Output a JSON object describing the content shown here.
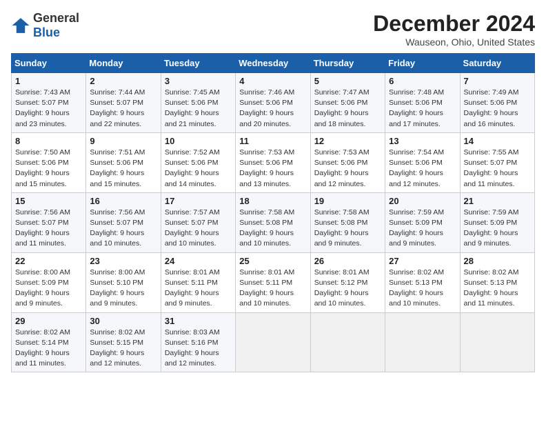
{
  "logo": {
    "general": "General",
    "blue": "Blue"
  },
  "title": "December 2024",
  "location": "Wauseon, Ohio, United States",
  "headers": [
    "Sunday",
    "Monday",
    "Tuesday",
    "Wednesday",
    "Thursday",
    "Friday",
    "Saturday"
  ],
  "weeks": [
    [
      {
        "day": "1",
        "sunrise": "Sunrise: 7:43 AM",
        "sunset": "Sunset: 5:07 PM",
        "daylight": "Daylight: 9 hours and 23 minutes."
      },
      {
        "day": "2",
        "sunrise": "Sunrise: 7:44 AM",
        "sunset": "Sunset: 5:07 PM",
        "daylight": "Daylight: 9 hours and 22 minutes."
      },
      {
        "day": "3",
        "sunrise": "Sunrise: 7:45 AM",
        "sunset": "Sunset: 5:06 PM",
        "daylight": "Daylight: 9 hours and 21 minutes."
      },
      {
        "day": "4",
        "sunrise": "Sunrise: 7:46 AM",
        "sunset": "Sunset: 5:06 PM",
        "daylight": "Daylight: 9 hours and 20 minutes."
      },
      {
        "day": "5",
        "sunrise": "Sunrise: 7:47 AM",
        "sunset": "Sunset: 5:06 PM",
        "daylight": "Daylight: 9 hours and 18 minutes."
      },
      {
        "day": "6",
        "sunrise": "Sunrise: 7:48 AM",
        "sunset": "Sunset: 5:06 PM",
        "daylight": "Daylight: 9 hours and 17 minutes."
      },
      {
        "day": "7",
        "sunrise": "Sunrise: 7:49 AM",
        "sunset": "Sunset: 5:06 PM",
        "daylight": "Daylight: 9 hours and 16 minutes."
      }
    ],
    [
      {
        "day": "8",
        "sunrise": "Sunrise: 7:50 AM",
        "sunset": "Sunset: 5:06 PM",
        "daylight": "Daylight: 9 hours and 15 minutes."
      },
      {
        "day": "9",
        "sunrise": "Sunrise: 7:51 AM",
        "sunset": "Sunset: 5:06 PM",
        "daylight": "Daylight: 9 hours and 15 minutes."
      },
      {
        "day": "10",
        "sunrise": "Sunrise: 7:52 AM",
        "sunset": "Sunset: 5:06 PM",
        "daylight": "Daylight: 9 hours and 14 minutes."
      },
      {
        "day": "11",
        "sunrise": "Sunrise: 7:53 AM",
        "sunset": "Sunset: 5:06 PM",
        "daylight": "Daylight: 9 hours and 13 minutes."
      },
      {
        "day": "12",
        "sunrise": "Sunrise: 7:53 AM",
        "sunset": "Sunset: 5:06 PM",
        "daylight": "Daylight: 9 hours and 12 minutes."
      },
      {
        "day": "13",
        "sunrise": "Sunrise: 7:54 AM",
        "sunset": "Sunset: 5:06 PM",
        "daylight": "Daylight: 9 hours and 12 minutes."
      },
      {
        "day": "14",
        "sunrise": "Sunrise: 7:55 AM",
        "sunset": "Sunset: 5:07 PM",
        "daylight": "Daylight: 9 hours and 11 minutes."
      }
    ],
    [
      {
        "day": "15",
        "sunrise": "Sunrise: 7:56 AM",
        "sunset": "Sunset: 5:07 PM",
        "daylight": "Daylight: 9 hours and 11 minutes."
      },
      {
        "day": "16",
        "sunrise": "Sunrise: 7:56 AM",
        "sunset": "Sunset: 5:07 PM",
        "daylight": "Daylight: 9 hours and 10 minutes."
      },
      {
        "day": "17",
        "sunrise": "Sunrise: 7:57 AM",
        "sunset": "Sunset: 5:07 PM",
        "daylight": "Daylight: 9 hours and 10 minutes."
      },
      {
        "day": "18",
        "sunrise": "Sunrise: 7:58 AM",
        "sunset": "Sunset: 5:08 PM",
        "daylight": "Daylight: 9 hours and 10 minutes."
      },
      {
        "day": "19",
        "sunrise": "Sunrise: 7:58 AM",
        "sunset": "Sunset: 5:08 PM",
        "daylight": "Daylight: 9 hours and 9 minutes."
      },
      {
        "day": "20",
        "sunrise": "Sunrise: 7:59 AM",
        "sunset": "Sunset: 5:09 PM",
        "daylight": "Daylight: 9 hours and 9 minutes."
      },
      {
        "day": "21",
        "sunrise": "Sunrise: 7:59 AM",
        "sunset": "Sunset: 5:09 PM",
        "daylight": "Daylight: 9 hours and 9 minutes."
      }
    ],
    [
      {
        "day": "22",
        "sunrise": "Sunrise: 8:00 AM",
        "sunset": "Sunset: 5:09 PM",
        "daylight": "Daylight: 9 hours and 9 minutes."
      },
      {
        "day": "23",
        "sunrise": "Sunrise: 8:00 AM",
        "sunset": "Sunset: 5:10 PM",
        "daylight": "Daylight: 9 hours and 9 minutes."
      },
      {
        "day": "24",
        "sunrise": "Sunrise: 8:01 AM",
        "sunset": "Sunset: 5:11 PM",
        "daylight": "Daylight: 9 hours and 9 minutes."
      },
      {
        "day": "25",
        "sunrise": "Sunrise: 8:01 AM",
        "sunset": "Sunset: 5:11 PM",
        "daylight": "Daylight: 9 hours and 10 minutes."
      },
      {
        "day": "26",
        "sunrise": "Sunrise: 8:01 AM",
        "sunset": "Sunset: 5:12 PM",
        "daylight": "Daylight: 9 hours and 10 minutes."
      },
      {
        "day": "27",
        "sunrise": "Sunrise: 8:02 AM",
        "sunset": "Sunset: 5:13 PM",
        "daylight": "Daylight: 9 hours and 10 minutes."
      },
      {
        "day": "28",
        "sunrise": "Sunrise: 8:02 AM",
        "sunset": "Sunset: 5:13 PM",
        "daylight": "Daylight: 9 hours and 11 minutes."
      }
    ],
    [
      {
        "day": "29",
        "sunrise": "Sunrise: 8:02 AM",
        "sunset": "Sunset: 5:14 PM",
        "daylight": "Daylight: 9 hours and 11 minutes."
      },
      {
        "day": "30",
        "sunrise": "Sunrise: 8:02 AM",
        "sunset": "Sunset: 5:15 PM",
        "daylight": "Daylight: 9 hours and 12 minutes."
      },
      {
        "day": "31",
        "sunrise": "Sunrise: 8:03 AM",
        "sunset": "Sunset: 5:16 PM",
        "daylight": "Daylight: 9 hours and 12 minutes."
      },
      null,
      null,
      null,
      null
    ]
  ]
}
